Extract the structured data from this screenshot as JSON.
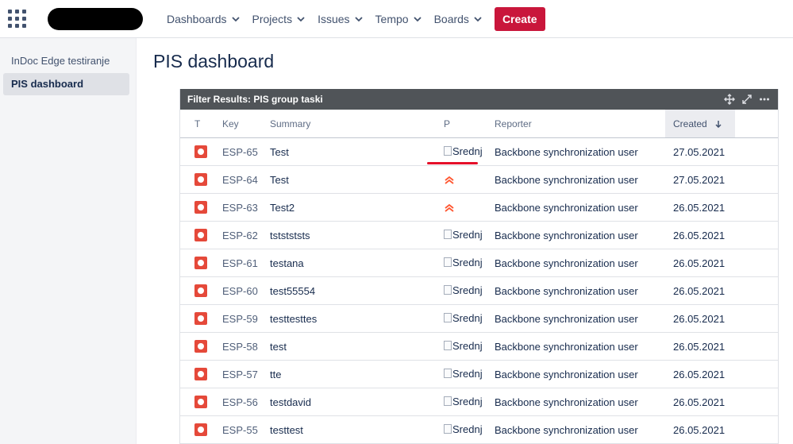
{
  "nav": {
    "items": [
      "Dashboards",
      "Projects",
      "Issues",
      "Tempo",
      "Boards"
    ],
    "create_label": "Create"
  },
  "sidebar": {
    "items": [
      {
        "label": "InDoc Edge testiranje",
        "active": false
      },
      {
        "label": "PIS dashboard",
        "active": true
      }
    ]
  },
  "page": {
    "title": "PIS dashboard"
  },
  "gadget": {
    "title": "Filter Results: PIS group taski",
    "columns": {
      "type": "T",
      "key": "Key",
      "summary": "Summary",
      "priority": "P",
      "reporter": "Reporter",
      "created": "Created"
    },
    "rows": [
      {
        "key": "ESP-65",
        "summary": "Test",
        "priority": "Srednj",
        "priority_icon": "broken-image",
        "reporter": "Backbone synchronization user",
        "created": "27.05.2021"
      },
      {
        "key": "ESP-64",
        "summary": "Test",
        "priority": "",
        "priority_icon": "highest-priority-icon",
        "reporter": "Backbone synchronization user",
        "created": "27.05.2021"
      },
      {
        "key": "ESP-63",
        "summary": "Test2",
        "priority": "",
        "priority_icon": "highest-priority-icon",
        "reporter": "Backbone synchronization user",
        "created": "26.05.2021"
      },
      {
        "key": "ESP-62",
        "summary": "tststststs",
        "priority": "Srednj",
        "priority_icon": "broken-image",
        "reporter": "Backbone synchronization user",
        "created": "26.05.2021"
      },
      {
        "key": "ESP-61",
        "summary": "testana",
        "priority": "Srednj",
        "priority_icon": "broken-image",
        "reporter": "Backbone synchronization user",
        "created": "26.05.2021"
      },
      {
        "key": "ESP-60",
        "summary": "test55554",
        "priority": "Srednj",
        "priority_icon": "broken-image",
        "reporter": "Backbone synchronization user",
        "created": "26.05.2021"
      },
      {
        "key": "ESP-59",
        "summary": "testtesttes",
        "priority": "Srednj",
        "priority_icon": "broken-image",
        "reporter": "Backbone synchronization user",
        "created": "26.05.2021"
      },
      {
        "key": "ESP-58",
        "summary": "test",
        "priority": "Srednj",
        "priority_icon": "broken-image",
        "reporter": "Backbone synchronization user",
        "created": "26.05.2021"
      },
      {
        "key": "ESP-57",
        "summary": "tte",
        "priority": "Srednj",
        "priority_icon": "broken-image",
        "reporter": "Backbone synchronization user",
        "created": "26.05.2021"
      },
      {
        "key": "ESP-56",
        "summary": "testdavid",
        "priority": "Srednj",
        "priority_icon": "broken-image",
        "reporter": "Backbone synchronization user",
        "created": "26.05.2021"
      },
      {
        "key": "ESP-55",
        "summary": "testtest",
        "priority": "Srednj",
        "priority_icon": "broken-image",
        "reporter": "Backbone synchronization user",
        "created": "26.05.2021"
      }
    ]
  },
  "colors": {
    "create": "#c9163b",
    "bug": "#e5493a",
    "priority_high": "#ff5630",
    "header": "#505458"
  },
  "icons": {
    "app_switcher": "grid-icon",
    "move": "move-icon",
    "expand": "expand-icon",
    "more": "more-icon",
    "sort": "arrow-down-icon",
    "bug": "bug-icon"
  }
}
